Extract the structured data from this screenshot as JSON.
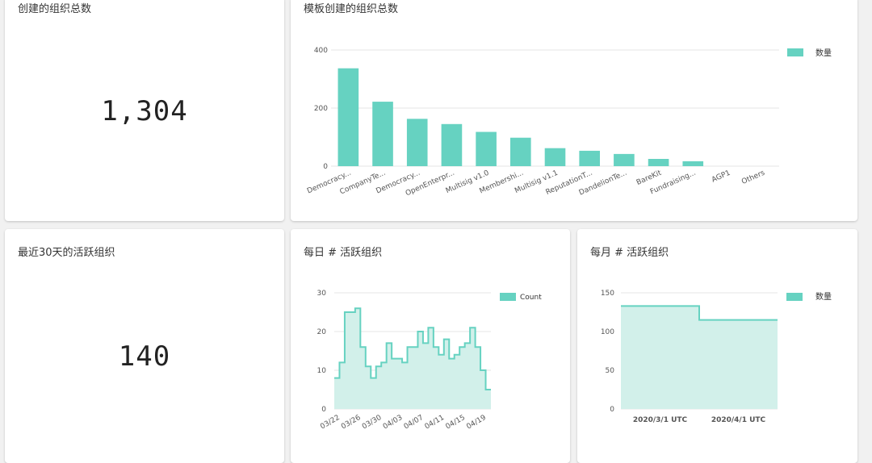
{
  "cards": {
    "total": {
      "title": "创建的组织总数",
      "value": "1,304"
    },
    "template": {
      "title": "模板创建的组织总数"
    },
    "active30": {
      "title": "最近30天的活跃组织",
      "value": "140"
    },
    "daily": {
      "title": "每日 # 活跃组织"
    },
    "monthly": {
      "title": "每月 # 活跃组织"
    }
  },
  "colors": {
    "accent": "#66d2c1",
    "area_fill": "#d2f0ea",
    "grid": "#e4e4e4"
  },
  "chart_data": [
    {
      "id": "template",
      "type": "bar",
      "categories": [
        "Democracy...",
        "CompanyTe...",
        "Democracy...",
        "OpenEnterpr...",
        "Multisig v1.0",
        "Membershi...",
        "Multisig v1.1",
        "ReputationT...",
        "DandelionTe...",
        "BareKit",
        "Fundraising...",
        "AGP1",
        "Others"
      ],
      "series": [
        {
          "name": "数量",
          "values": [
            337,
            222,
            163,
            145,
            118,
            98,
            62,
            53,
            42,
            25,
            17,
            0,
            0
          ]
        }
      ],
      "ylim": [
        0,
        400
      ],
      "yticks": [
        0,
        200,
        400
      ],
      "grid": true,
      "legend": "top-right"
    },
    {
      "id": "daily",
      "type": "area",
      "x": [
        "03/22",
        "03/23",
        "03/24",
        "03/25",
        "03/26",
        "03/27",
        "03/28",
        "03/29",
        "03/30",
        "03/31",
        "04/01",
        "04/02",
        "04/03",
        "04/04",
        "04/05",
        "04/06",
        "04/07",
        "04/08",
        "04/09",
        "04/10",
        "04/11",
        "04/12",
        "04/13",
        "04/14",
        "04/15",
        "04/16",
        "04/17",
        "04/18",
        "04/19",
        "04/20"
      ],
      "xticks": [
        "03/22",
        "03/26",
        "03/30",
        "04/03",
        "04/07",
        "04/11",
        "04/15",
        "04/19"
      ],
      "series": [
        {
          "name": "Count",
          "values": [
            8,
            12,
            25,
            25,
            26,
            16,
            11,
            8,
            11,
            12,
            17,
            13,
            13,
            12,
            16,
            16,
            20,
            17,
            21,
            16,
            14,
            18,
            13,
            14,
            16,
            17,
            21,
            16,
            10,
            5
          ]
        }
      ],
      "ylim": [
        0,
        30
      ],
      "yticks": [
        0,
        10,
        20,
        30
      ],
      "grid": true,
      "legend": "top-right"
    },
    {
      "id": "monthly",
      "type": "area",
      "x": [
        "2020/3/1 UTC",
        "2020/4/1 UTC"
      ],
      "series": [
        {
          "name": "数量",
          "values": [
            133,
            115
          ]
        }
      ],
      "ylim": [
        0,
        150
      ],
      "yticks": [
        0,
        50,
        100,
        150
      ],
      "grid": true,
      "legend": "top-right"
    }
  ]
}
